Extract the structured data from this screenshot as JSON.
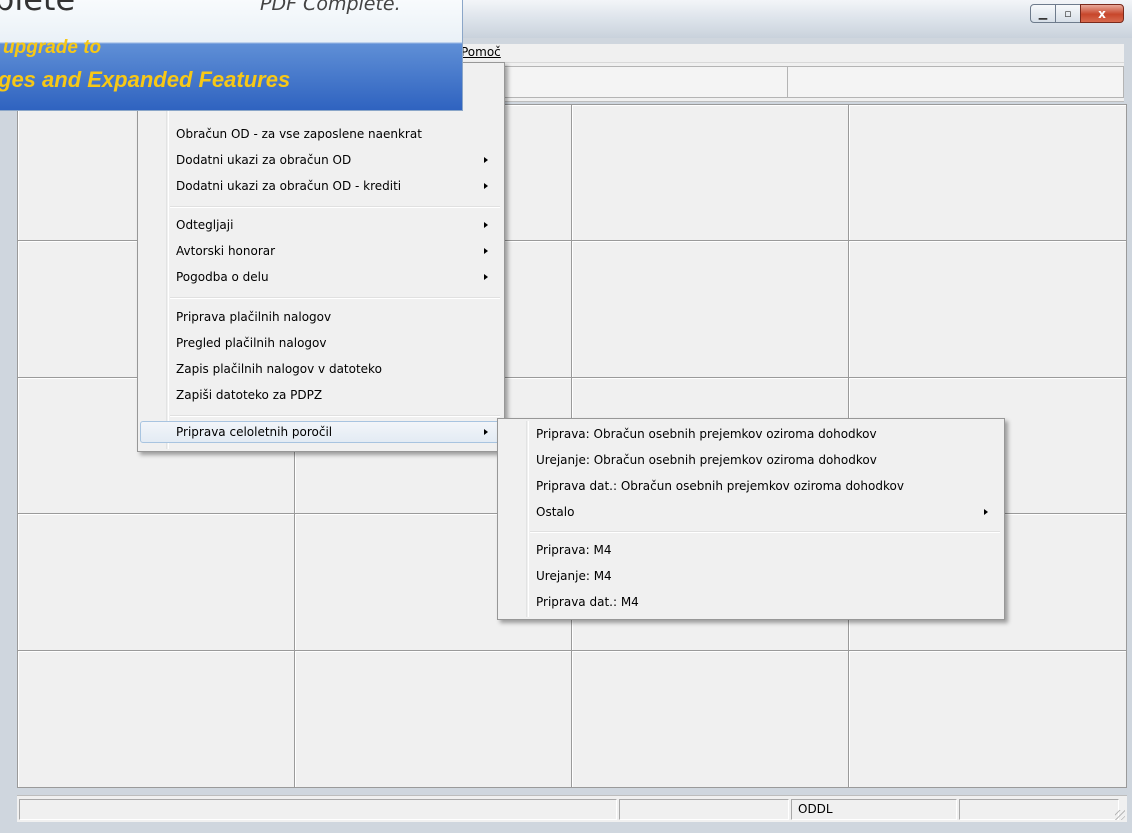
{
  "menubar": {
    "visible_menu": "Pomoč"
  },
  "main_menu": {
    "items": [
      {
        "label": "Obračun OD - za vse zaposlene naenkrat",
        "submenu": false
      },
      {
        "label": "Dodatni ukazi za obračun OD",
        "submenu": true
      },
      {
        "label": "Dodatni ukazi za obračun OD - krediti",
        "submenu": true
      },
      {
        "label": "Odtegljaji",
        "submenu": true
      },
      {
        "label": "Avtorski honorar",
        "submenu": true
      },
      {
        "label": "Pogodba o delu",
        "submenu": true
      },
      {
        "label": "Priprava plačilnih nalogov",
        "submenu": false
      },
      {
        "label": "Pregled plačilnih nalogov",
        "submenu": false
      },
      {
        "label": "Zapis plačilnih nalogov v datoteko",
        "submenu": false
      },
      {
        "label": "Zapiši datoteko za PDPZ",
        "submenu": false
      },
      {
        "label": "Priprava celoletnih poročil",
        "submenu": true,
        "highlighted": true
      }
    ]
  },
  "sub_menu": {
    "items": [
      {
        "label": "Priprava: Obračun osebnih prejemkov oziroma dohodkov",
        "submenu": false
      },
      {
        "label": "Urejanje: Obračun osebnih prejemkov oziroma dohodkov",
        "submenu": false
      },
      {
        "label": "Priprava dat.: Obračun osebnih prejemkov oziroma dohodkov",
        "submenu": false
      },
      {
        "label": "Ostalo",
        "submenu": true
      },
      {
        "label": "Priprava: M4",
        "submenu": false
      },
      {
        "label": "Urejanje: M4",
        "submenu": false
      },
      {
        "label": "Priprava dat.: M4",
        "submenu": false
      }
    ]
  },
  "statusbar": {
    "panel_text": "ODDL"
  },
  "banner": {
    "brand_fragment": "plete",
    "product_fragment": "PDF Complete.",
    "line1": "upgrade to",
    "line2": "ges and Expanded Features"
  },
  "window": {
    "min_icon": "minimize-icon",
    "max_icon": "maximize-icon",
    "close_icon": "close-icon",
    "close_glyph": "x"
  }
}
